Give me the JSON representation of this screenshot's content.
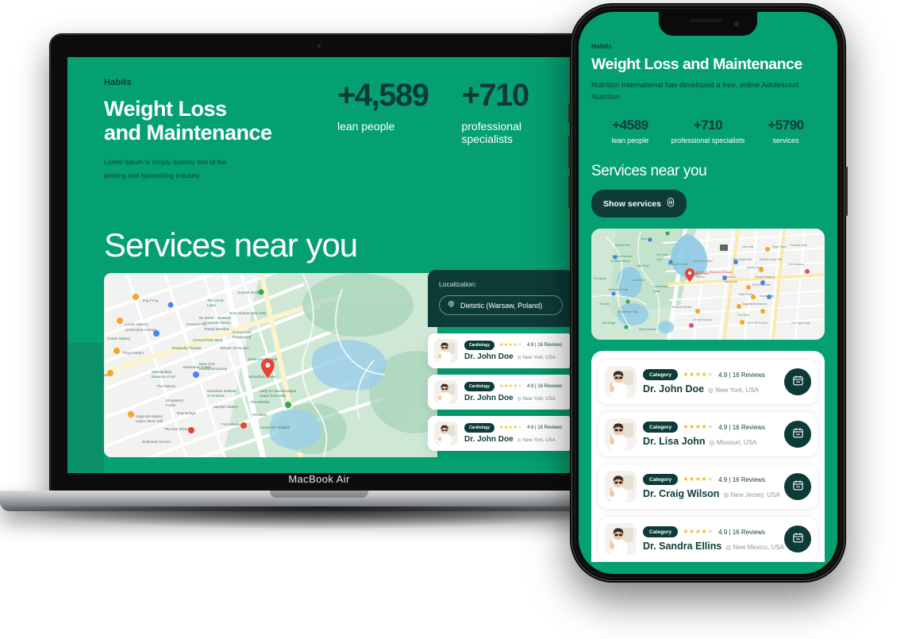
{
  "laptop": {
    "device_label": "MacBook Air",
    "kicker": "Habits",
    "title_line1": "Weight Loss",
    "title_line2": "and Maintenance",
    "subtitle_line1": "Lorem Ipsum is simply dummy text of the",
    "subtitle_line2": "printing and typesetting industry.",
    "stats": [
      {
        "value": "+4,589",
        "label": "lean people"
      },
      {
        "value": "+710",
        "label": "professional specialists"
      }
    ],
    "section_heading": "Services near you",
    "panel": {
      "localization_label": "Localization:",
      "localization_value": "Dietetic (Warsaw, Poland)"
    },
    "cards": [
      {
        "category": "Cardiology",
        "rating": "4.9 | 16 Reviews",
        "stars_filled": 4,
        "stars_total": 5,
        "name": "Dr. John Doe",
        "location": "New York, USA"
      },
      {
        "category": "Cardiology",
        "rating": "4.9 | 16 Reviews",
        "stars_filled": 4,
        "stars_total": 5,
        "name": "Dr. John Doe",
        "location": "New York, USA"
      },
      {
        "category": "Cardiology",
        "rating": "4.9 | 16 Reviews",
        "stars_filled": 4,
        "stars_total": 5,
        "name": "Dr. John Doe",
        "location": "New York, USA"
      }
    ]
  },
  "phone": {
    "kicker": "Habits",
    "title": "Weight Loss and Maintenance",
    "subtitle": "Nutrition International has developed a free, online Adolescent Nutrition",
    "stats": [
      {
        "value": "+4589",
        "label": "lean people"
      },
      {
        "value": "+710",
        "label": "professional specialists"
      },
      {
        "value": "+5790",
        "label": "services"
      }
    ],
    "section_heading": "Services near you",
    "show_services_button": "Show services",
    "cards": [
      {
        "category": "Category",
        "rating": "4.9 | 16 Reviews",
        "stars_filled": 4,
        "stars_total": 5,
        "name": "Dr. John Doe",
        "location": "New York, USA"
      },
      {
        "category": "Category",
        "rating": "4.9 | 16 Reviews",
        "stars_filled": 4,
        "stars_total": 5,
        "name": "Dr. Lisa John",
        "location": "Missouri, USA"
      },
      {
        "category": "Category",
        "rating": "4.9 | 16 Reviews",
        "stars_filled": 4,
        "stars_total": 5,
        "name": "Dr. Craig Wilson",
        "location": "New Jersey, USA"
      },
      {
        "category": "Category",
        "rating": "4.9 | 16 Reviews",
        "stars_filled": 4,
        "stars_total": 5,
        "name": "Dr. Sandra Ellins",
        "location": "New Mexico, USA"
      }
    ]
  },
  "map": {
    "provider_style": "google-maps",
    "region": "Central Park / Upper West Side, New York",
    "labels": [
      "Jing Fong",
      "Levain Bakery - Amsterdam Avenue",
      "Playa Betty's",
      "Summit Rock",
      "81 Street - Museum of Natural History",
      "Central Park West",
      "New-York Historical Society",
      "Delacorte Theater",
      "Belvedere Castle",
      "The Ramble",
      "The San Remo",
      "Bethesda Terrace",
      "The Dakota",
      "Strawberry Fields",
      "Bow Bridge",
      "The Lake",
      "The Great Lawn",
      "Metropolitan Museum of Art",
      "Lenox Hill Hospital",
      "Frick Madison",
      "The Mark",
      "Magnolia Bakery Upper West Side",
      "Ukrainian Institute of America",
      "Dragonfly Theater",
      "Sheep Meadow",
      "Diana Ross Playground",
      "Heckscher Playground"
    ],
    "marker_color": "#ea4335"
  },
  "colors": {
    "brand_green": "#05A072",
    "brand_green_dark": "#0b8f69",
    "deep_teal": "#0d3b38",
    "star_gold": "#f5b820",
    "star_grey": "#d7dbda",
    "white": "#ffffff"
  },
  "icons": {
    "location_pin": "location-pin-icon",
    "fingerprint": "fingerprint-icon",
    "calendar": "calendar-icon"
  }
}
